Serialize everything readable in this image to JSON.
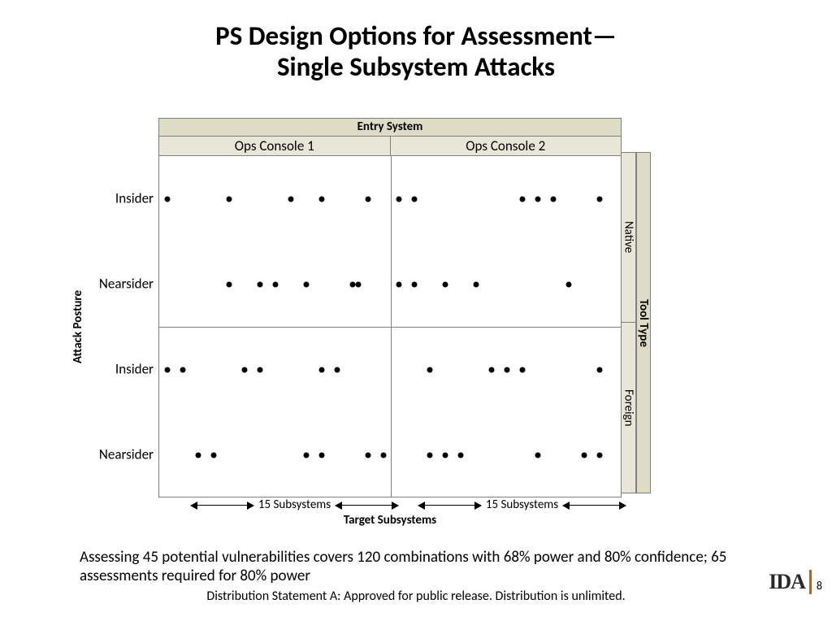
{
  "title_line1": "PS Design Options for Assessment—",
  "title_line2": "Single Subsystem Attacks",
  "headers": {
    "entry_system": "Entry System",
    "ops1": "Ops Console 1",
    "ops2": "Ops Console 2"
  },
  "y_axis_title": "Attack Posture",
  "row_labels": {
    "insider1": "Insider",
    "nearsider1": "Nearsider",
    "insider2": "Insider",
    "nearsider2": "Nearsider"
  },
  "right_strips": {
    "tool_type": "Tool Type",
    "native": "Native",
    "foreign": "Foreign"
  },
  "subsystems": {
    "left": "15 Subsystems",
    "right": "15 Subsystems",
    "title": "Target Subsystems"
  },
  "assessment": "Assessing 45 potential vulnerabilities covers 120 combinations with 68% power and 80% confidence; 65 assessments required for 80% power",
  "distribution": "Distribution Statement A:  Approved for public release.  Distribution is unlimited.",
  "logo_text": "IDA",
  "page_number": "8",
  "chart_data": {
    "type": "scatter",
    "title": "PS Design Options for Assessment—Single Subsystem Attacks",
    "xlabel": "Target Subsystems",
    "ylabel": "Attack Posture",
    "x_facets": [
      "Ops Console 1",
      "Ops Console 2"
    ],
    "y_outer_facet": "Tool Type",
    "y_outer_levels": [
      "Native",
      "Foreign"
    ],
    "y_inner_levels": [
      "Insider",
      "Nearsider"
    ],
    "subsystems_per_console": 15,
    "note": "Approx. 45 vulnerabilities plotted across 120 combinations",
    "points": [
      {
        "tool": "Native",
        "posture": "Insider",
        "console": 1,
        "sub": 1
      },
      {
        "tool": "Native",
        "posture": "Insider",
        "console": 1,
        "sub": 5
      },
      {
        "tool": "Native",
        "posture": "Insider",
        "console": 1,
        "sub": 9
      },
      {
        "tool": "Native",
        "posture": "Insider",
        "console": 1,
        "sub": 11
      },
      {
        "tool": "Native",
        "posture": "Insider",
        "console": 1,
        "sub": 14
      },
      {
        "tool": "Native",
        "posture": "Insider",
        "console": 2,
        "sub": 1
      },
      {
        "tool": "Native",
        "posture": "Insider",
        "console": 2,
        "sub": 2
      },
      {
        "tool": "Native",
        "posture": "Insider",
        "console": 2,
        "sub": 9
      },
      {
        "tool": "Native",
        "posture": "Insider",
        "console": 2,
        "sub": 10
      },
      {
        "tool": "Native",
        "posture": "Insider",
        "console": 2,
        "sub": 11
      },
      {
        "tool": "Native",
        "posture": "Insider",
        "console": 2,
        "sub": 14
      },
      {
        "tool": "Native",
        "posture": "Nearsider",
        "console": 1,
        "sub": 5
      },
      {
        "tool": "Native",
        "posture": "Nearsider",
        "console": 1,
        "sub": 7
      },
      {
        "tool": "Native",
        "posture": "Nearsider",
        "console": 1,
        "sub": 8
      },
      {
        "tool": "Native",
        "posture": "Nearsider",
        "console": 1,
        "sub": 10
      },
      {
        "tool": "Native",
        "posture": "Nearsider",
        "console": 1,
        "sub": 13
      },
      {
        "tool": "Native",
        "posture": "Nearsider",
        "console": 1,
        "sub": 13.4
      },
      {
        "tool": "Native",
        "posture": "Nearsider",
        "console": 2,
        "sub": 1
      },
      {
        "tool": "Native",
        "posture": "Nearsider",
        "console": 2,
        "sub": 2
      },
      {
        "tool": "Native",
        "posture": "Nearsider",
        "console": 2,
        "sub": 4
      },
      {
        "tool": "Native",
        "posture": "Nearsider",
        "console": 2,
        "sub": 6
      },
      {
        "tool": "Native",
        "posture": "Nearsider",
        "console": 2,
        "sub": 12
      },
      {
        "tool": "Foreign",
        "posture": "Insider",
        "console": 1,
        "sub": 1
      },
      {
        "tool": "Foreign",
        "posture": "Insider",
        "console": 1,
        "sub": 2
      },
      {
        "tool": "Foreign",
        "posture": "Insider",
        "console": 1,
        "sub": 6
      },
      {
        "tool": "Foreign",
        "posture": "Insider",
        "console": 1,
        "sub": 7
      },
      {
        "tool": "Foreign",
        "posture": "Insider",
        "console": 1,
        "sub": 11
      },
      {
        "tool": "Foreign",
        "posture": "Insider",
        "console": 1,
        "sub": 12
      },
      {
        "tool": "Foreign",
        "posture": "Insider",
        "console": 2,
        "sub": 3
      },
      {
        "tool": "Foreign",
        "posture": "Insider",
        "console": 2,
        "sub": 7
      },
      {
        "tool": "Foreign",
        "posture": "Insider",
        "console": 2,
        "sub": 8
      },
      {
        "tool": "Foreign",
        "posture": "Insider",
        "console": 2,
        "sub": 9
      },
      {
        "tool": "Foreign",
        "posture": "Insider",
        "console": 2,
        "sub": 14
      },
      {
        "tool": "Foreign",
        "posture": "Nearsider",
        "console": 1,
        "sub": 3
      },
      {
        "tool": "Foreign",
        "posture": "Nearsider",
        "console": 1,
        "sub": 4
      },
      {
        "tool": "Foreign",
        "posture": "Nearsider",
        "console": 1,
        "sub": 10
      },
      {
        "tool": "Foreign",
        "posture": "Nearsider",
        "console": 1,
        "sub": 11
      },
      {
        "tool": "Foreign",
        "posture": "Nearsider",
        "console": 1,
        "sub": 14
      },
      {
        "tool": "Foreign",
        "posture": "Nearsider",
        "console": 1,
        "sub": 15
      },
      {
        "tool": "Foreign",
        "posture": "Nearsider",
        "console": 2,
        "sub": 3
      },
      {
        "tool": "Foreign",
        "posture": "Nearsider",
        "console": 2,
        "sub": 4
      },
      {
        "tool": "Foreign",
        "posture": "Nearsider",
        "console": 2,
        "sub": 5
      },
      {
        "tool": "Foreign",
        "posture": "Nearsider",
        "console": 2,
        "sub": 10
      },
      {
        "tool": "Foreign",
        "posture": "Nearsider",
        "console": 2,
        "sub": 13
      },
      {
        "tool": "Foreign",
        "posture": "Nearsider",
        "console": 2,
        "sub": 14
      }
    ]
  }
}
